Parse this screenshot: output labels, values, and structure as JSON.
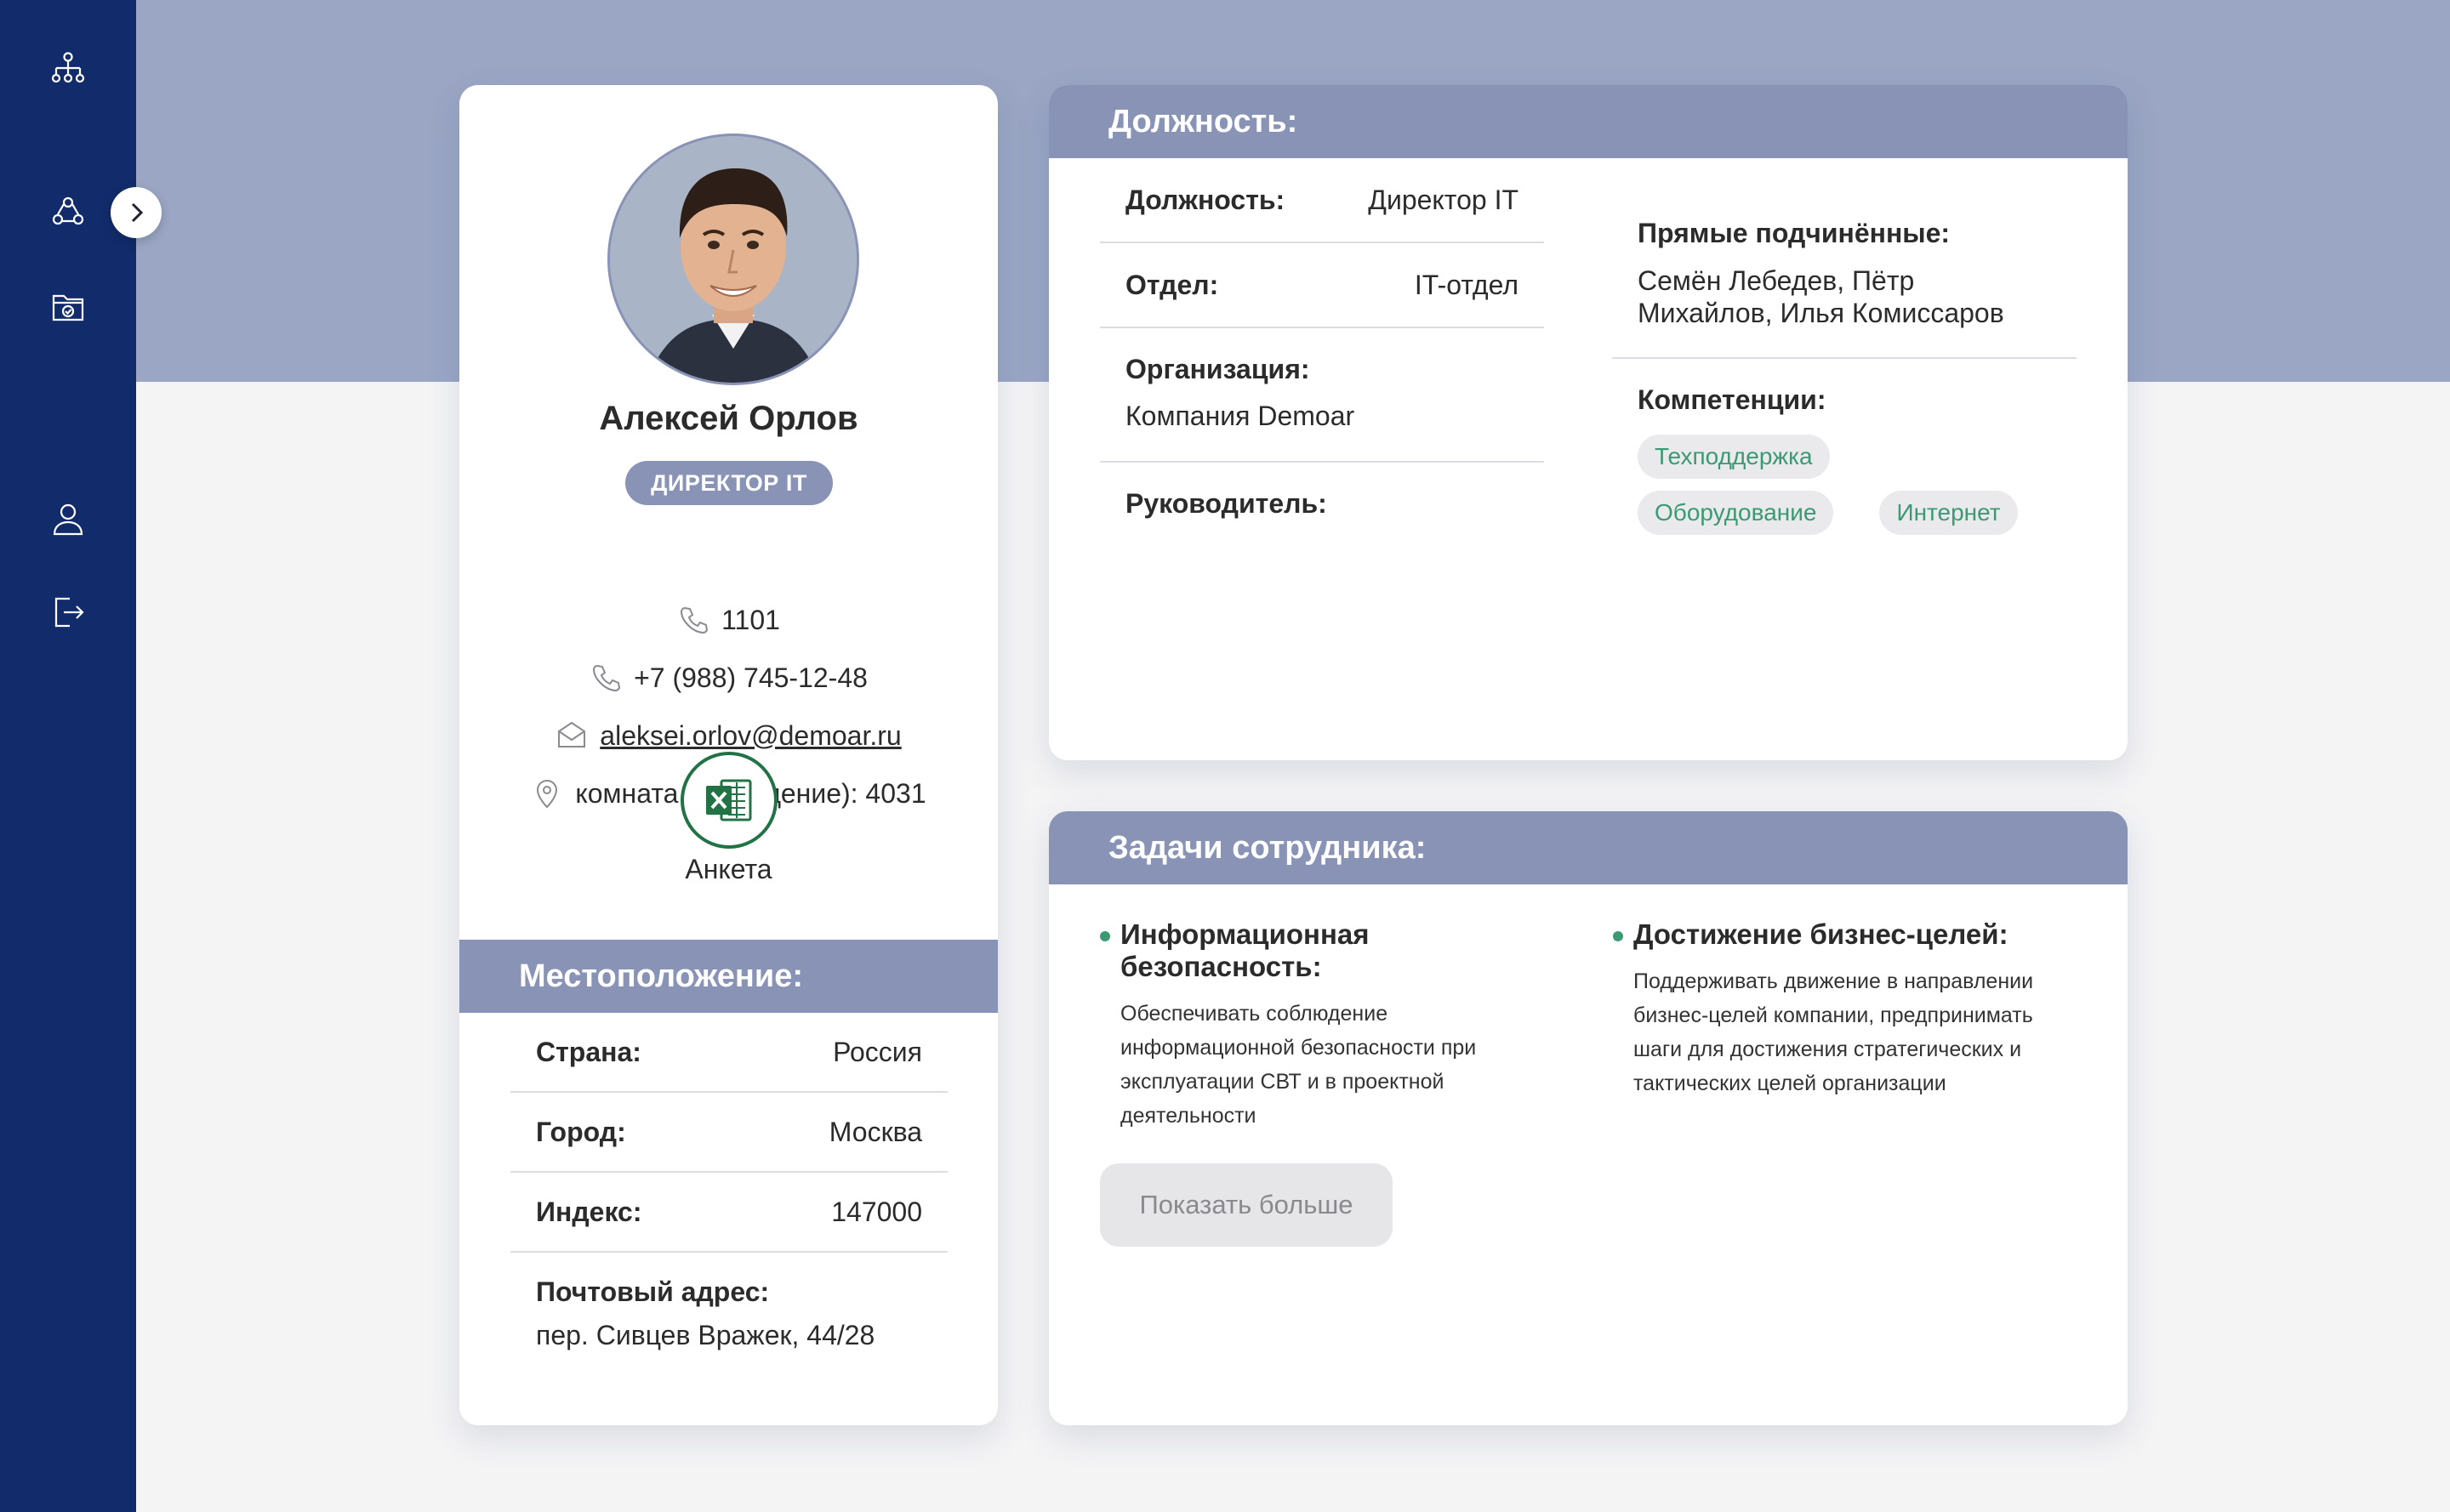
{
  "profile": {
    "name": "Алексей Орлов",
    "role": "ДИРЕКТОР IT",
    "ext": "1101",
    "phone": "+7 (988) 745-12-48",
    "email": "aleksei.orlov@demoar.ru",
    "room": "комната (помещение): 4031",
    "form_label": "Анкета"
  },
  "location": {
    "title": "Местоположение:",
    "rows": [
      {
        "label": "Страна:",
        "value": "Россия"
      },
      {
        "label": "Город:",
        "value": "Москва"
      },
      {
        "label": "Индекс:",
        "value": "147000"
      }
    ],
    "address_label": "Почтовый адрес:",
    "address_value": "пер. Сивцев Вражек, 44/28"
  },
  "position": {
    "title": "Должность:",
    "rows": [
      {
        "label": "Должность:",
        "value": "Директор IT"
      },
      {
        "label": "Отдел:",
        "value": "IT-отдел"
      }
    ],
    "org_label": "Организация:",
    "org_value": "Компания Demoar",
    "manager_label": "Руководитель:",
    "subordinates_label": "Прямые подчинённые:",
    "subordinates_value": "Семён Лебедев, Пётр Михайлов, Илья Комиссаров",
    "competencies_label": "Компетенции:",
    "competencies": [
      "Техподдержка",
      "Оборудование",
      "Интернет"
    ]
  },
  "tasks": {
    "title": "Задачи сотрудника:",
    "items": [
      {
        "title": "Информационная безопасность:",
        "desc": "Обеспечивать соблюдение информационной безопасности при эксплуатации СВТ и в проектной деятельности"
      },
      {
        "title": "Достижение бизнес-целей:",
        "desc": "Поддерживать движение в направлении бизнес-целей компании, предпринимать шаги для достижения стратегических и тактических целей организации"
      }
    ],
    "show_more": "Показать больше"
  },
  "sidebar": {
    "icons": [
      "org-structure-icon",
      "groups-icon",
      "documents-icon",
      "user-icon",
      "logout-icon"
    ]
  },
  "colors": {
    "sidebar": "#122c6b",
    "band": "#9aa6c4",
    "header": "#8893b6",
    "accent_green": "#3a9a73"
  }
}
